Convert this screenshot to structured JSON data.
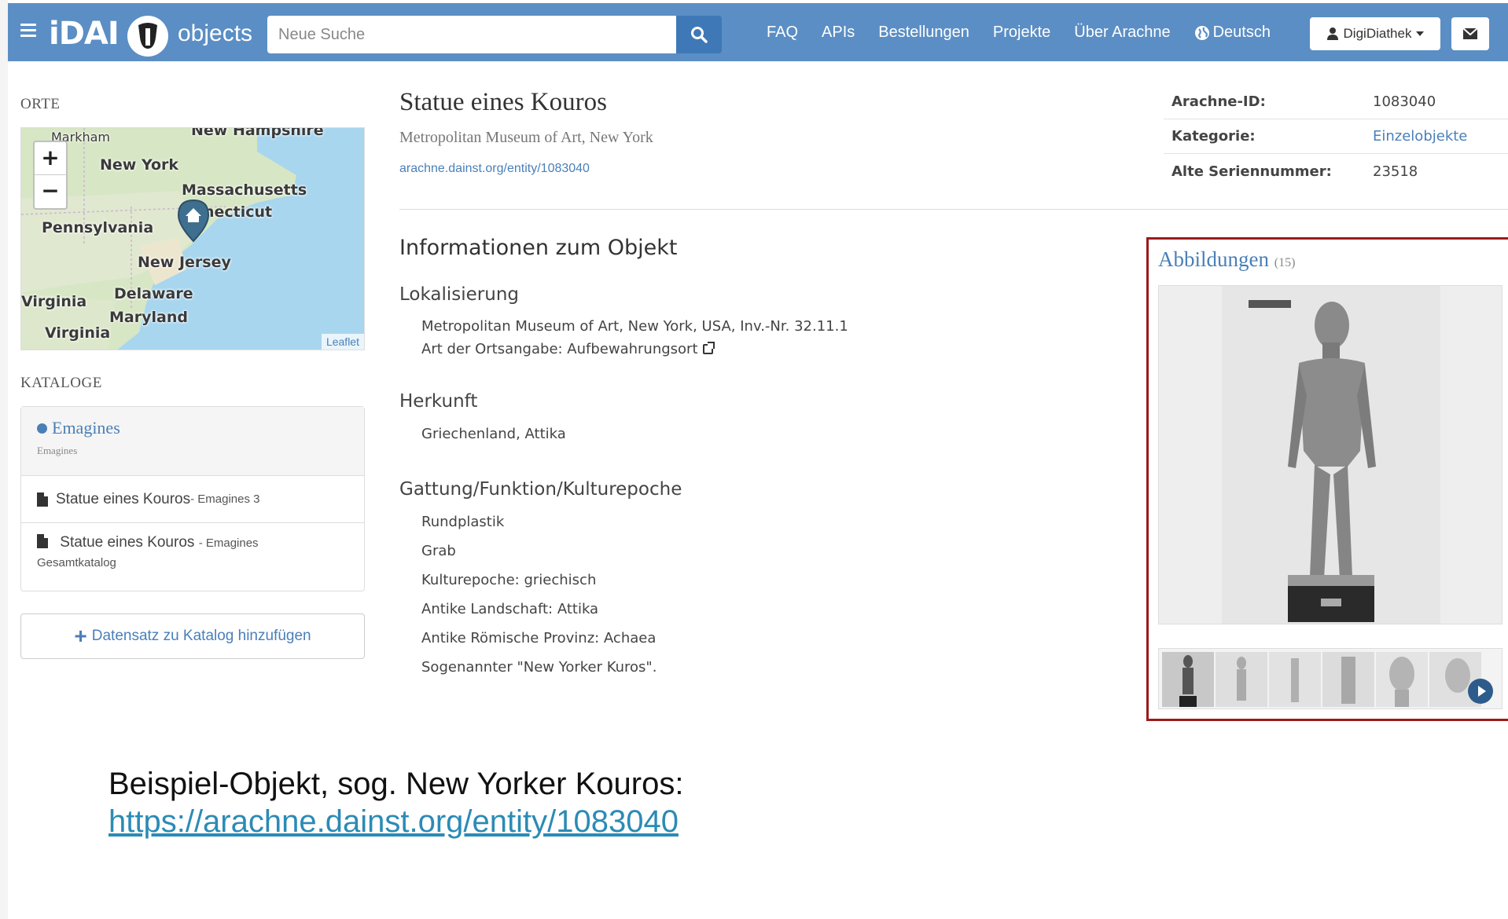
{
  "navbar": {
    "brand": "iDAI",
    "brand_sub": "objects",
    "search_placeholder": "Neue Suche",
    "links": [
      "FAQ",
      "APIs",
      "Bestellungen",
      "Projekte",
      "Über Arachne"
    ],
    "language": "Deutsch",
    "user": "DigiDiathek",
    "accent_color": "#5b8ec4"
  },
  "sidebar": {
    "places_label": "ORTE",
    "map": {
      "labels": [
        "Markham",
        "New Hampshire",
        "New York",
        "Massachusetts",
        "necticut",
        "Pennsylvania",
        "New Jersey",
        "Delaware",
        "Virginia",
        "Maryland",
        "Virginia"
      ],
      "zoom_in": "+",
      "zoom_out": "−",
      "attribution": "Leaflet"
    },
    "catalogs_label": "KATALOGE",
    "catalog": {
      "name": "Emagines",
      "sub": "Emagines",
      "entries": [
        {
          "title": "Statue eines Kouros",
          "suffix": " - Emagines 3",
          "extra": ""
        },
        {
          "title": "Statue eines Kouros",
          "suffix": " - Emagines",
          "extra": "Gesamtkatalog"
        }
      ]
    },
    "add_button": "Datensatz zu Katalog hinzufügen"
  },
  "main": {
    "title": "Statue eines Kouros",
    "subtitle": "Metropolitan Museum of Art, New York",
    "link": "arachne.dainst.org/entity/1083040",
    "info_heading": "Informationen zum Objekt",
    "sections": {
      "loc_heading": "Lokalisierung",
      "loc_line1": "Metropolitan Museum of Art, New York, USA, Inv.-Nr. 32.11.1",
      "loc_line2": "Art der Ortsangabe: Aufbewahrungsort",
      "origin_heading": "Herkunft",
      "origin_line": "Griechenland, Attika",
      "genre_heading": "Gattung/Funktion/Kulturepoche",
      "genre_lines": [
        "Rundplastik",
        "Grab",
        "Kulturepoche: griechisch",
        "Antike Landschaft: Attika",
        "Antike Römische Provinz: Achaea",
        "Sogenannter \"New Yorker Kuros\"."
      ]
    }
  },
  "meta": {
    "rows": [
      {
        "key": "Arachne-ID:",
        "value": "1083040"
      },
      {
        "key": "Kategorie:",
        "value": "Einzelobjekte"
      },
      {
        "key": "Alte Seriennummer:",
        "value": "23518"
      }
    ]
  },
  "images": {
    "title": "Abbildungen",
    "count": "(15)",
    "highlight_color": "#9b1a1a"
  },
  "caption": {
    "text": "Beispiel-Objekt, sog. New Yorker Kouros:",
    "link": "https://arachne.dainst.org/entity/1083040"
  }
}
